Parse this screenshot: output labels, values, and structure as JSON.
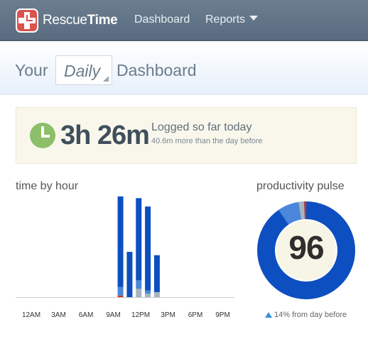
{
  "nav": {
    "brand_plain": "Rescue",
    "brand_bold": "Time",
    "dashboard": "Dashboard",
    "reports": "Reports"
  },
  "header": {
    "prefix": "Your",
    "period": "Daily",
    "suffix": "Dashboard"
  },
  "summary": {
    "time": "3h 26m",
    "label": "Logged so far today",
    "comparison": "40.6m more than the day before"
  },
  "sections": {
    "time_by_hour": "time by hour",
    "productivity_pulse": "productivity pulse"
  },
  "pulse": {
    "score": "96",
    "change": "14% from day before"
  },
  "colors": {
    "very_productive": "#0d4fc0",
    "productive": "#4a86dc",
    "neutral": "#a8b4be",
    "distracting": "#c0392b",
    "clock": "#8dbf6a"
  },
  "chart_data": {
    "type": "bar",
    "title": "time by hour",
    "hour_labels": [
      "12AM",
      "3AM",
      "6AM",
      "9AM",
      "12PM",
      "3PM",
      "6PM",
      "9PM"
    ],
    "hours": [
      11,
      12,
      13,
      14,
      15
    ],
    "stacked_minutes": [
      {
        "hour": 11,
        "very_productive": 54,
        "productive": 5,
        "neutral": 0,
        "distracting": 1
      },
      {
        "hour": 12,
        "very_productive": 27,
        "productive": 0,
        "neutral": 0,
        "distracting": 0
      },
      {
        "hour": 13,
        "very_productive": 49,
        "productive": 5,
        "neutral": 5,
        "distracting": 0
      },
      {
        "hour": 14,
        "very_productive": 50,
        "productive": 2,
        "neutral": 2,
        "distracting": 0
      },
      {
        "hour": 15,
        "very_productive": 22,
        "productive": 0,
        "neutral": 3,
        "distracting": 0
      }
    ],
    "ylim": [
      0,
      60
    ]
  }
}
